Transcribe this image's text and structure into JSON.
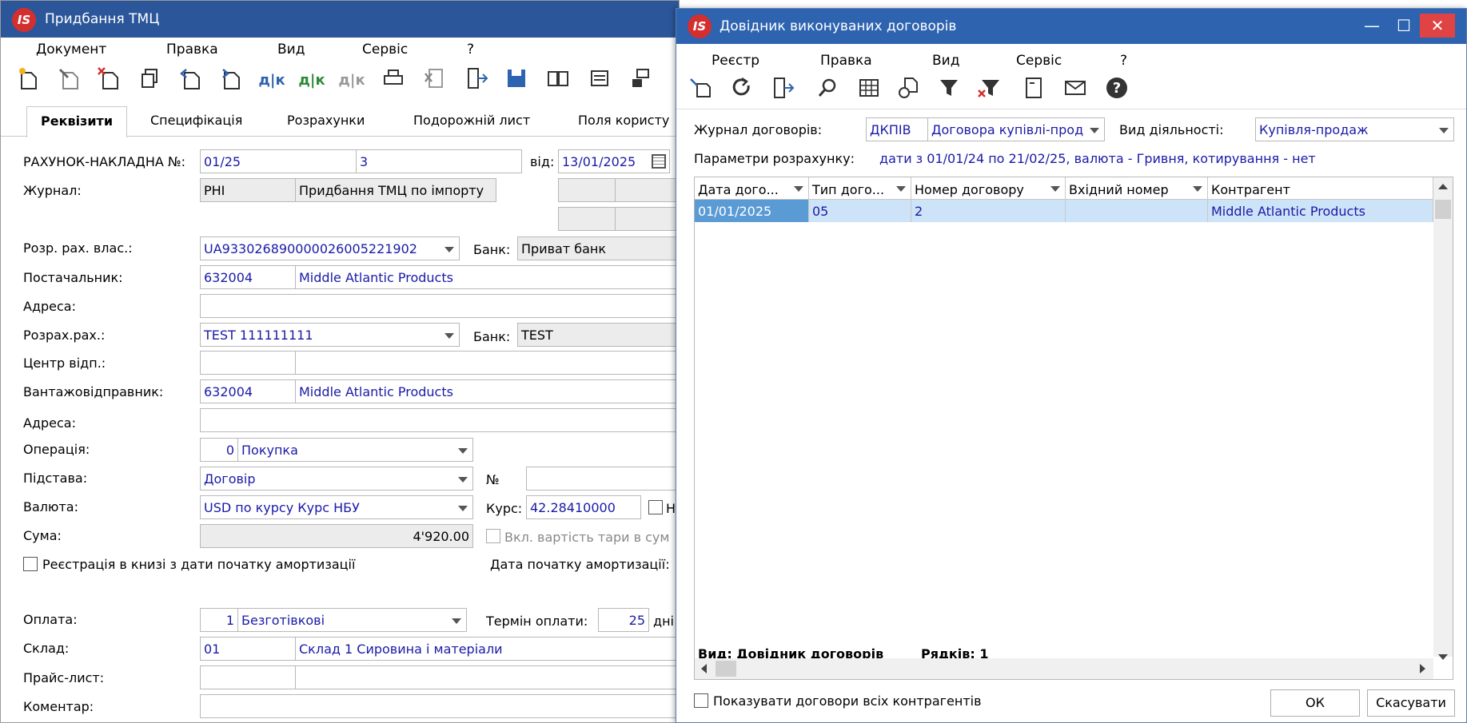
{
  "main_window": {
    "title": "Придбання ТМЦ",
    "logo": "IS",
    "menu": [
      "Документ",
      "Правка",
      "Вид",
      "Сервіс",
      "?"
    ],
    "toolbar_icons": [
      "new-doc-icon",
      "edit-doc-icon",
      "delete-doc-icon",
      "copy-icon",
      "import-icon",
      "export-icon",
      "debit-credit-icon",
      "debit-credit-green-icon",
      "debit-credit-gray-icon",
      "print-icon",
      "excel-icon",
      "exit-icon",
      "save-icon",
      "book-icon",
      "list-icon",
      "post-icon"
    ],
    "tabs": [
      "Реквізити",
      "Специфікація",
      "Розрахунки",
      "Подорожній лист",
      "Поля користу"
    ],
    "form": {
      "invoice_label": "РАХУНОК-НАКЛАДНА №:",
      "invoice_no": "01/25",
      "invoice_no2": "3",
      "date_label": "від:",
      "date": "13/01/2025",
      "journal_label": "Журнал:",
      "journal_code": "РНІ",
      "journal_name": "Придбання ТМЦ по імпорту",
      "own_account_label": "Розр. рах. влас.:",
      "own_account": "UA933026890000026005221902",
      "bank_label": "Банк:",
      "bank": "Приват банк",
      "supplier_label": "Постачальник:",
      "supplier_code": "632004",
      "supplier_name": "Middle Atlantic Products",
      "address_label": "Адреса:",
      "settlement_label": "Розрах.рах.:",
      "settlement": "TEST 111111111",
      "bank2_label": "Банк:",
      "bank2": "TEST",
      "center_label": "Центр відп.:",
      "shipper_label": "Вантажовідправник:",
      "shipper_code": "632004",
      "shipper_name": "Middle Atlantic Products",
      "address2_label": "Адреса:",
      "operation_label": "Операція:",
      "operation_code": "0",
      "operation_name": "Покупка",
      "basis_label": "Підстава:",
      "basis": "Договір",
      "number_label": "№",
      "currency_label": "Валюта:",
      "currency": "USD по курсу Курс НБУ",
      "rate_label": "Курс:",
      "rate": "42.28410000",
      "rate_chk_label": "Н",
      "sum_label": "Сума:",
      "sum": "4'920.00",
      "tara_label": "Вкл. вартість тари в сум",
      "registration_label": "Реєстрація в книзі з дати початку амортизації",
      "amort_date_label": "Дата початку амортизації:",
      "payment_label": "Оплата:",
      "payment_code": "1",
      "payment_name": "Безготівкові",
      "term_label": "Термін оплати:",
      "term": "25",
      "term_unit": "дні",
      "warehouse_label": "Склад:",
      "warehouse_code": "01",
      "warehouse_name": "Склад 1 Сировина і матеріали",
      "price_label": "Прайс-лист:",
      "comment_label": "Коментар:"
    }
  },
  "dialog": {
    "title": "Довідник виконуваних договорів",
    "logo": "IS",
    "menu": [
      "Реєстр",
      "Правка",
      "Вид",
      "Сервіс",
      "?"
    ],
    "toolbar_icons": [
      "select-icon",
      "refresh-icon",
      "exit-icon",
      "search-icon",
      "grid-icon",
      "history-icon",
      "filter-icon",
      "clear-filter-icon",
      "document-icon",
      "mail-icon",
      "help-icon"
    ],
    "journal_label": "Журнал договорів:",
    "journal_code": "ДКПІВ",
    "journal_name": "Договора купівлі-прод",
    "activity_label": "Вид діяльності:",
    "activity": "Купівля-продаж",
    "params_label": "Параметри розрахунку:",
    "params_value": "дати з 01/01/24 по 21/02/25, валюта - Гривня, котирування - нет",
    "columns": [
      "Дата дого...",
      "Тип дого...",
      "Номер договору",
      "Вхідний номер",
      "Контрагент"
    ],
    "rows": [
      [
        "01/01/2025",
        "05",
        "2",
        "",
        "Middle Atlantic Products"
      ]
    ],
    "status_view": "Вид: Довідник договорів",
    "status_rows": "Рядків: 1",
    "show_all_label": "Показувати договори всіх контрагентів",
    "ok": "ОК",
    "cancel": "Скасувати"
  }
}
